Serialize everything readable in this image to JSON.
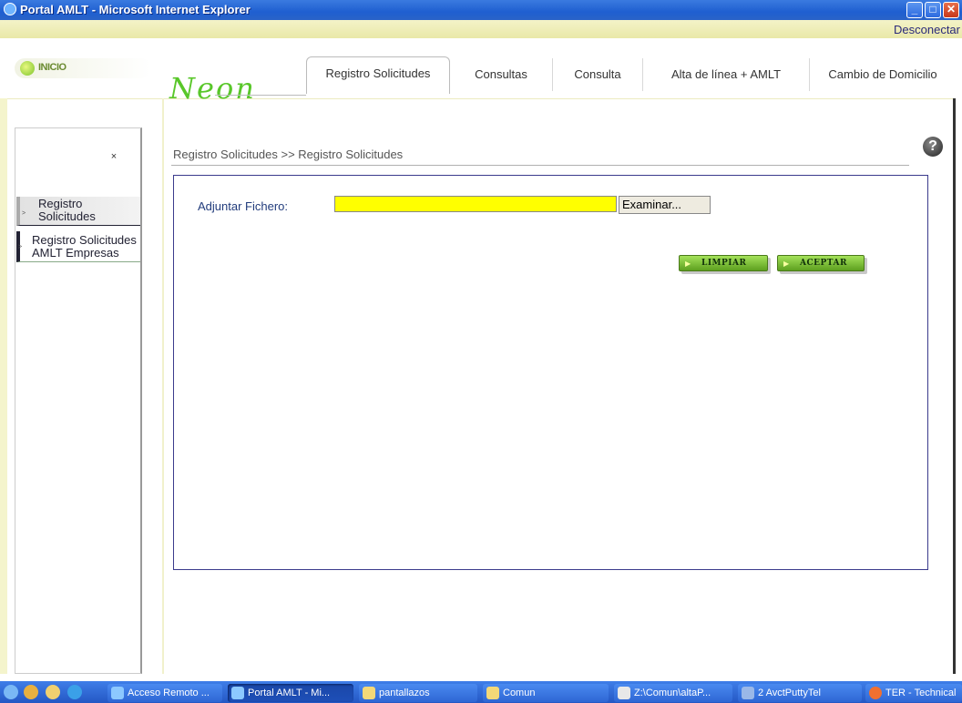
{
  "window": {
    "title": "Portal AMLT - Microsoft Internet Explorer",
    "min_glyph": "_",
    "max_glyph": "□",
    "close_glyph": "✕"
  },
  "header": {
    "disconnect": "Desconectar",
    "home": "INICIO",
    "logo": "Neon",
    "tabs": [
      "Registro Solicitudes",
      "Consultas",
      "Consulta",
      "Alta de línea + AMLT",
      "Cambio de Domicilio"
    ]
  },
  "sidebar": {
    "close_glyph": "×",
    "items": [
      {
        "label": "Registro Solicitudes"
      },
      {
        "label": "Registro Solicitudes AMLT Empresas"
      }
    ]
  },
  "main": {
    "breadcrumb": "Registro Solicitudes >> Registro Solicitudes",
    "help_glyph": "?",
    "file_label": "Adjuntar Fichero:",
    "file_value": "",
    "browse_label": "Examinar...",
    "clear_label": "LIMPIAR",
    "accept_label": "ACEPTAR"
  },
  "taskbar": {
    "items": [
      "Acceso Remoto ...",
      "Portal AMLT - Mi...",
      "pantallazos",
      "Comun",
      "Z:\\Comun\\altaP...",
      "2 AvctPuttyTel",
      "TER - Technical"
    ]
  },
  "colors": {
    "accent": "#59c72a",
    "field_highlight": "#ffff00",
    "panel_border": "#3a3a8c"
  }
}
